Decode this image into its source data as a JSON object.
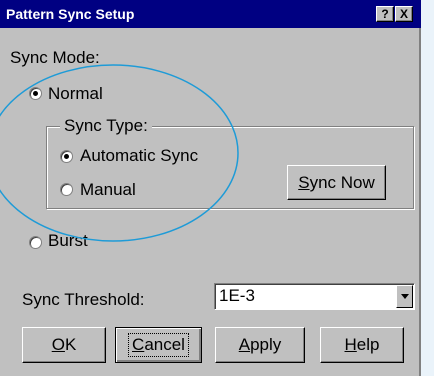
{
  "window": {
    "title": "Pattern Sync Setup",
    "help_button": "?",
    "close_button": "X"
  },
  "sync_mode": {
    "label": "Sync Mode:",
    "options": [
      {
        "label": "Normal",
        "checked": true
      },
      {
        "label": "Burst",
        "checked": false
      }
    ]
  },
  "sync_type": {
    "label": "Sync Type:",
    "options": [
      {
        "label": "Automatic Sync",
        "checked": true
      },
      {
        "label": "Manual",
        "checked": false
      }
    ],
    "sync_now_button": "Sync Now"
  },
  "threshold": {
    "label": "Sync Threshold:",
    "value": "1E-3"
  },
  "buttons": {
    "ok": "OK",
    "cancel": "Cancel",
    "apply": "Apply",
    "help": "Help"
  },
  "colors": {
    "titlebar": "#000082",
    "face": "#c0c0c0",
    "annotation_circle": "#1e9bd7"
  }
}
